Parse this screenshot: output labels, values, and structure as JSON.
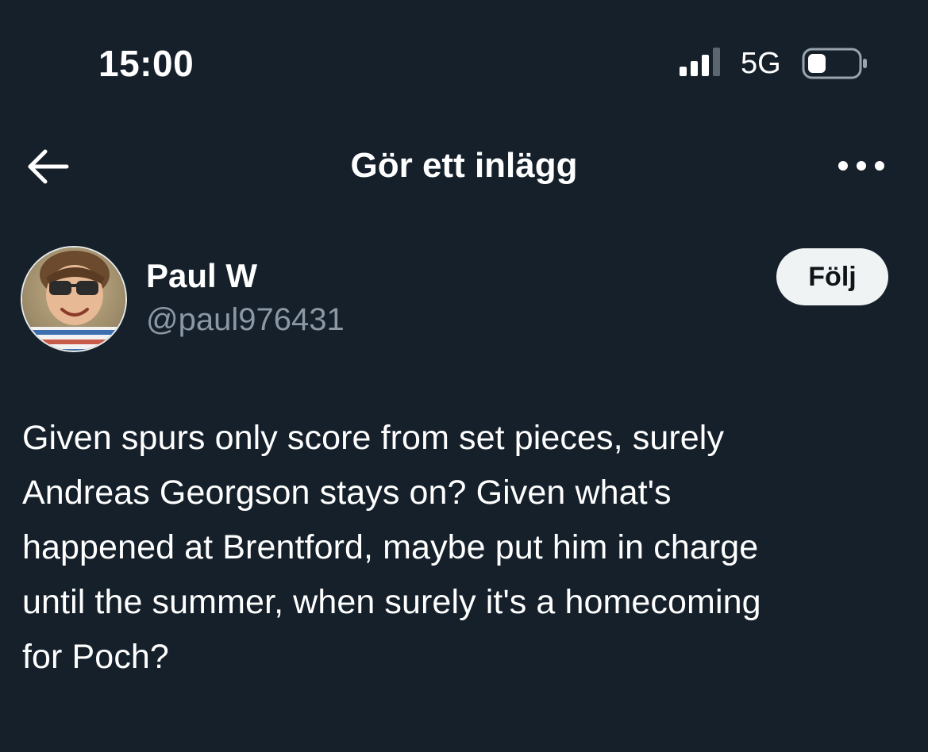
{
  "status_bar": {
    "time": "15:00",
    "network": "5G",
    "signal_icon": "cellular-signal-icon",
    "battery_icon": "battery-icon"
  },
  "header": {
    "back_icon": "arrow-left-icon",
    "title": "Gör ett inlägg",
    "more_icon": "more-horizontal-icon"
  },
  "author": {
    "display_name": "Paul W",
    "handle": "@paul976431",
    "follow_label": "Följ"
  },
  "tweet": {
    "lines": [
      "Given spurs only score from set pieces, surely",
      "Andreas Georgson stays on? Given what's",
      "happened at Brentford, maybe put him in charge",
      "until the summer, when surely it's a homecoming",
      "for Poch?"
    ]
  },
  "colors": {
    "background": "#15202b",
    "text_primary": "#ffffff",
    "text_secondary": "#8b98a5",
    "follow_bg": "#eff3f4",
    "follow_text": "#0f1419"
  }
}
